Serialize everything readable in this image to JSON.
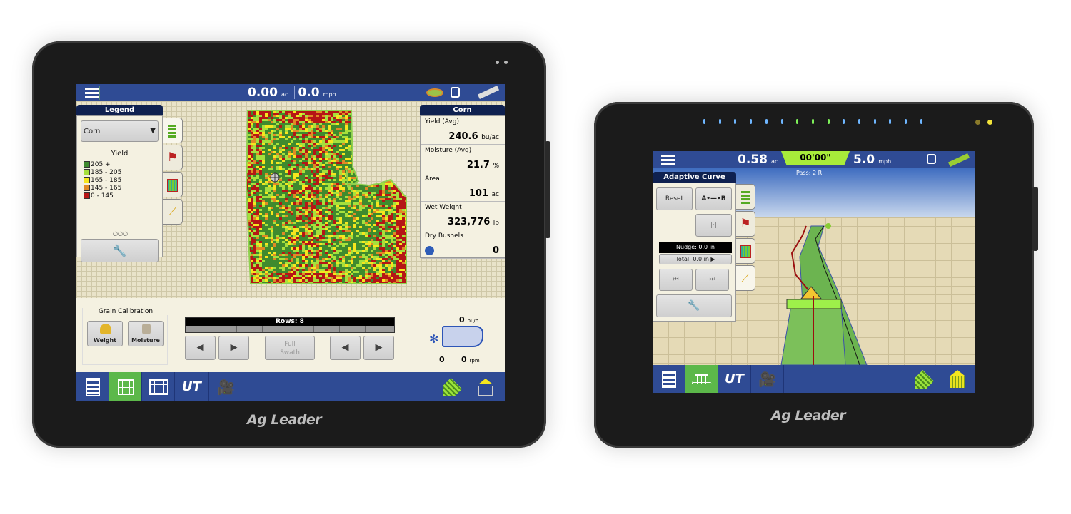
{
  "left_display": {
    "topbar": {
      "area_value": "0.00",
      "area_unit": "ac",
      "speed_value": "0.0",
      "speed_unit": "mph"
    },
    "legend": {
      "title": "Legend",
      "crop_select": "Corn",
      "layer": "Yield",
      "ranges": [
        {
          "label": "205 +",
          "color": "#3f8a2e"
        },
        {
          "label": "185 - 205",
          "color": "#a6e03c"
        },
        {
          "label": "165 - 185",
          "color": "#f5e61e"
        },
        {
          "label": "145 - 165",
          "color": "#e08a25"
        },
        {
          "label": "0 - 145",
          "color": "#b51616"
        }
      ]
    },
    "stats": {
      "title": "Corn",
      "items": [
        {
          "label": "Yield (Avg)",
          "value": "240.6",
          "unit": "bu/ac"
        },
        {
          "label": "Moisture (Avg)",
          "value": "21.7",
          "unit": "%"
        },
        {
          "label": "Area",
          "value": "101",
          "unit": "ac"
        },
        {
          "label": "Wet Weight",
          "value": "323,776",
          "unit": "lb"
        },
        {
          "label": "Dry Bushels",
          "value": "0",
          "unit": ""
        }
      ]
    },
    "grain_calibration": {
      "title": "Grain Calibration",
      "weight": "Weight",
      "moisture": "Moisture"
    },
    "rows": {
      "label": "Rows: 8",
      "full_swath": "Full Swath"
    },
    "combine": {
      "flow_value": "0",
      "flow_unit": "bu/h",
      "fan_value": "0",
      "rpm_value": "0",
      "rpm_unit": "rpm"
    },
    "brand": "Ag Leader"
  },
  "right_display": {
    "topbar": {
      "area_value": "0.58",
      "area_unit": "ac",
      "offset": "00'00\"",
      "speed_value": "5.0",
      "speed_unit": "mph"
    },
    "pass": "Pass: 2 R",
    "guidance": {
      "title": "Adaptive Curve",
      "reset": "Reset",
      "ab": "A•—•B",
      "nudge": "Nudge: 0.0 in",
      "total": "Total: 0.0 in ▶"
    },
    "brand": "Ag Leader"
  },
  "colors": {
    "bar": "#2f4b94",
    "header": "#0f2150",
    "active_tab": "#5cb84a",
    "lime": "#a8ec3a"
  }
}
